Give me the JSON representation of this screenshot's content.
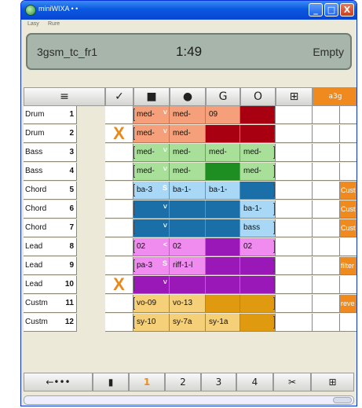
{
  "window": {
    "title": "miniWIXA • •",
    "controls": {
      "minimize": "_",
      "maximize": "□",
      "close": "X"
    }
  },
  "menu": [
    "Lasy",
    "Rure"
  ],
  "display": {
    "song": "3gsm_tc_fr1",
    "time": "1:49",
    "status": "Empty"
  },
  "header": {
    "menu_icon": "≡",
    "mute_icon": "✓",
    "stop_icon": "■",
    "record_icon": "●",
    "g_label": "G",
    "o_label": "O",
    "edit_icon": "⊞",
    "a3g_label": "a3g"
  },
  "tracks": [
    {
      "name": "Drum",
      "num": "1",
      "mute": "",
      "slots": [
        {
          "text": "med-",
          "mark": "˅",
          "color": "#f5a07a"
        },
        {
          "text": "med-",
          "color": "#f5a07a"
        },
        {
          "text": "09",
          "color": "#f5a07a"
        },
        {
          "text": "",
          "color": "#a80010"
        }
      ],
      "fx": ""
    },
    {
      "name": "Drum",
      "num": "2",
      "mute": "X",
      "slots": [
        {
          "text": "med-",
          "mark": "˅",
          "color": "#f5a07a"
        },
        {
          "text": "med-",
          "color": "#f5a07a"
        },
        {
          "text": "",
          "color": "#a80010"
        },
        {
          "text": "",
          "color": "#a80010"
        }
      ],
      "fx": ""
    },
    {
      "name": "Bass",
      "num": "3",
      "mute": "",
      "slots": [
        {
          "text": "med-",
          "mark": "˅",
          "color": "#a8e09a"
        },
        {
          "text": "med-",
          "color": "#a8e09a"
        },
        {
          "text": "med-",
          "color": "#a8e09a"
        },
        {
          "text": "med-",
          "color": "#a8e09a"
        }
      ],
      "fx": ""
    },
    {
      "name": "Bass",
      "num": "4",
      "mute": "",
      "slots": [
        {
          "text": "med-",
          "mark": "˅",
          "color": "#a8e09a"
        },
        {
          "text": "med-",
          "color": "#a8e09a"
        },
        {
          "text": "",
          "color": "#1e8e22"
        },
        {
          "text": "med-",
          "color": "#a8e09a"
        }
      ],
      "fx": ""
    },
    {
      "name": "Chord",
      "num": "5",
      "mute": "",
      "slots": [
        {
          "text": "ba-3",
          "mark": "S",
          "color": "#a8d8f5"
        },
        {
          "text": "ba-1-",
          "color": "#a8d8f5"
        },
        {
          "text": "ba-1-",
          "color": "#a8d8f5"
        },
        {
          "text": "",
          "color": "#1a6fa8"
        }
      ],
      "fx": "Cust"
    },
    {
      "name": "Chord",
      "num": "6",
      "mute": "",
      "slots": [
        {
          "text": "",
          "mark": "˅",
          "color": "#1a6fa8"
        },
        {
          "text": "",
          "color": "#1a6fa8"
        },
        {
          "text": "",
          "color": "#1a6fa8"
        },
        {
          "text": "ba-1-",
          "color": "#a8d8f5"
        }
      ],
      "fx": "Cust"
    },
    {
      "name": "Chord",
      "num": "7",
      "mute": "",
      "slots": [
        {
          "text": "",
          "mark": "˅",
          "color": "#1a6fa8"
        },
        {
          "text": "",
          "color": "#1a6fa8"
        },
        {
          "text": "",
          "color": "#1a6fa8"
        },
        {
          "text": "bass",
          "color": "#a8d8f5"
        }
      ],
      "fx": "Cust"
    },
    {
      "name": "Lead",
      "num": "8",
      "mute": "",
      "slots": [
        {
          "text": "02",
          "mark": "˂",
          "color": "#f08cf0"
        },
        {
          "text": "02",
          "color": "#f08cf0"
        },
        {
          "text": "",
          "color": "#9a18b8"
        },
        {
          "text": "02",
          "color": "#f08cf0"
        }
      ],
      "fx": ""
    },
    {
      "name": "Lead",
      "num": "9",
      "mute": "",
      "slots": [
        {
          "text": "pa-3",
          "mark": "S",
          "color": "#f08cf0"
        },
        {
          "text": "riff-1-l",
          "color": "#f08cf0"
        },
        {
          "text": "",
          "color": "#9a18b8"
        },
        {
          "text": "",
          "color": "#9a18b8"
        }
      ],
      "fx": "filter"
    },
    {
      "name": "Lead",
      "num": "10",
      "mute": "X",
      "slots": [
        {
          "text": "",
          "mark": "˅",
          "color": "#9a18b8"
        },
        {
          "text": "",
          "color": "#9a18b8"
        },
        {
          "text": "",
          "color": "#9a18b8"
        },
        {
          "text": "",
          "color": "#9a18b8"
        }
      ],
      "fx": ""
    },
    {
      "name": "Custm",
      "num": "11",
      "mute": "",
      "slots": [
        {
          "text": "vo-09",
          "color": "#f5d078"
        },
        {
          "text": "vo-13",
          "color": "#f5d078"
        },
        {
          "text": "",
          "color": "#e09a10"
        },
        {
          "text": "",
          "color": "#e09a10"
        }
      ],
      "fx": "reve"
    },
    {
      "name": "Custm",
      "num": "12",
      "mute": "",
      "slots": [
        {
          "text": "sy-10",
          "color": "#f5d078"
        },
        {
          "text": "sy-7a",
          "color": "#f5d078"
        },
        {
          "text": "sy-1a",
          "color": "#f5d078"
        },
        {
          "text": "",
          "color": "#e09a10"
        }
      ],
      "fx": ""
    }
  ],
  "toolbar": {
    "back": "←•••",
    "new": "▮",
    "slot1": "1",
    "slot2": "2",
    "slot3": "3",
    "slot4": "4",
    "tools": "✂",
    "grid": "⊞"
  },
  "colors": {
    "accent": "#f08a1e",
    "titlebar": "#0a58e0"
  }
}
